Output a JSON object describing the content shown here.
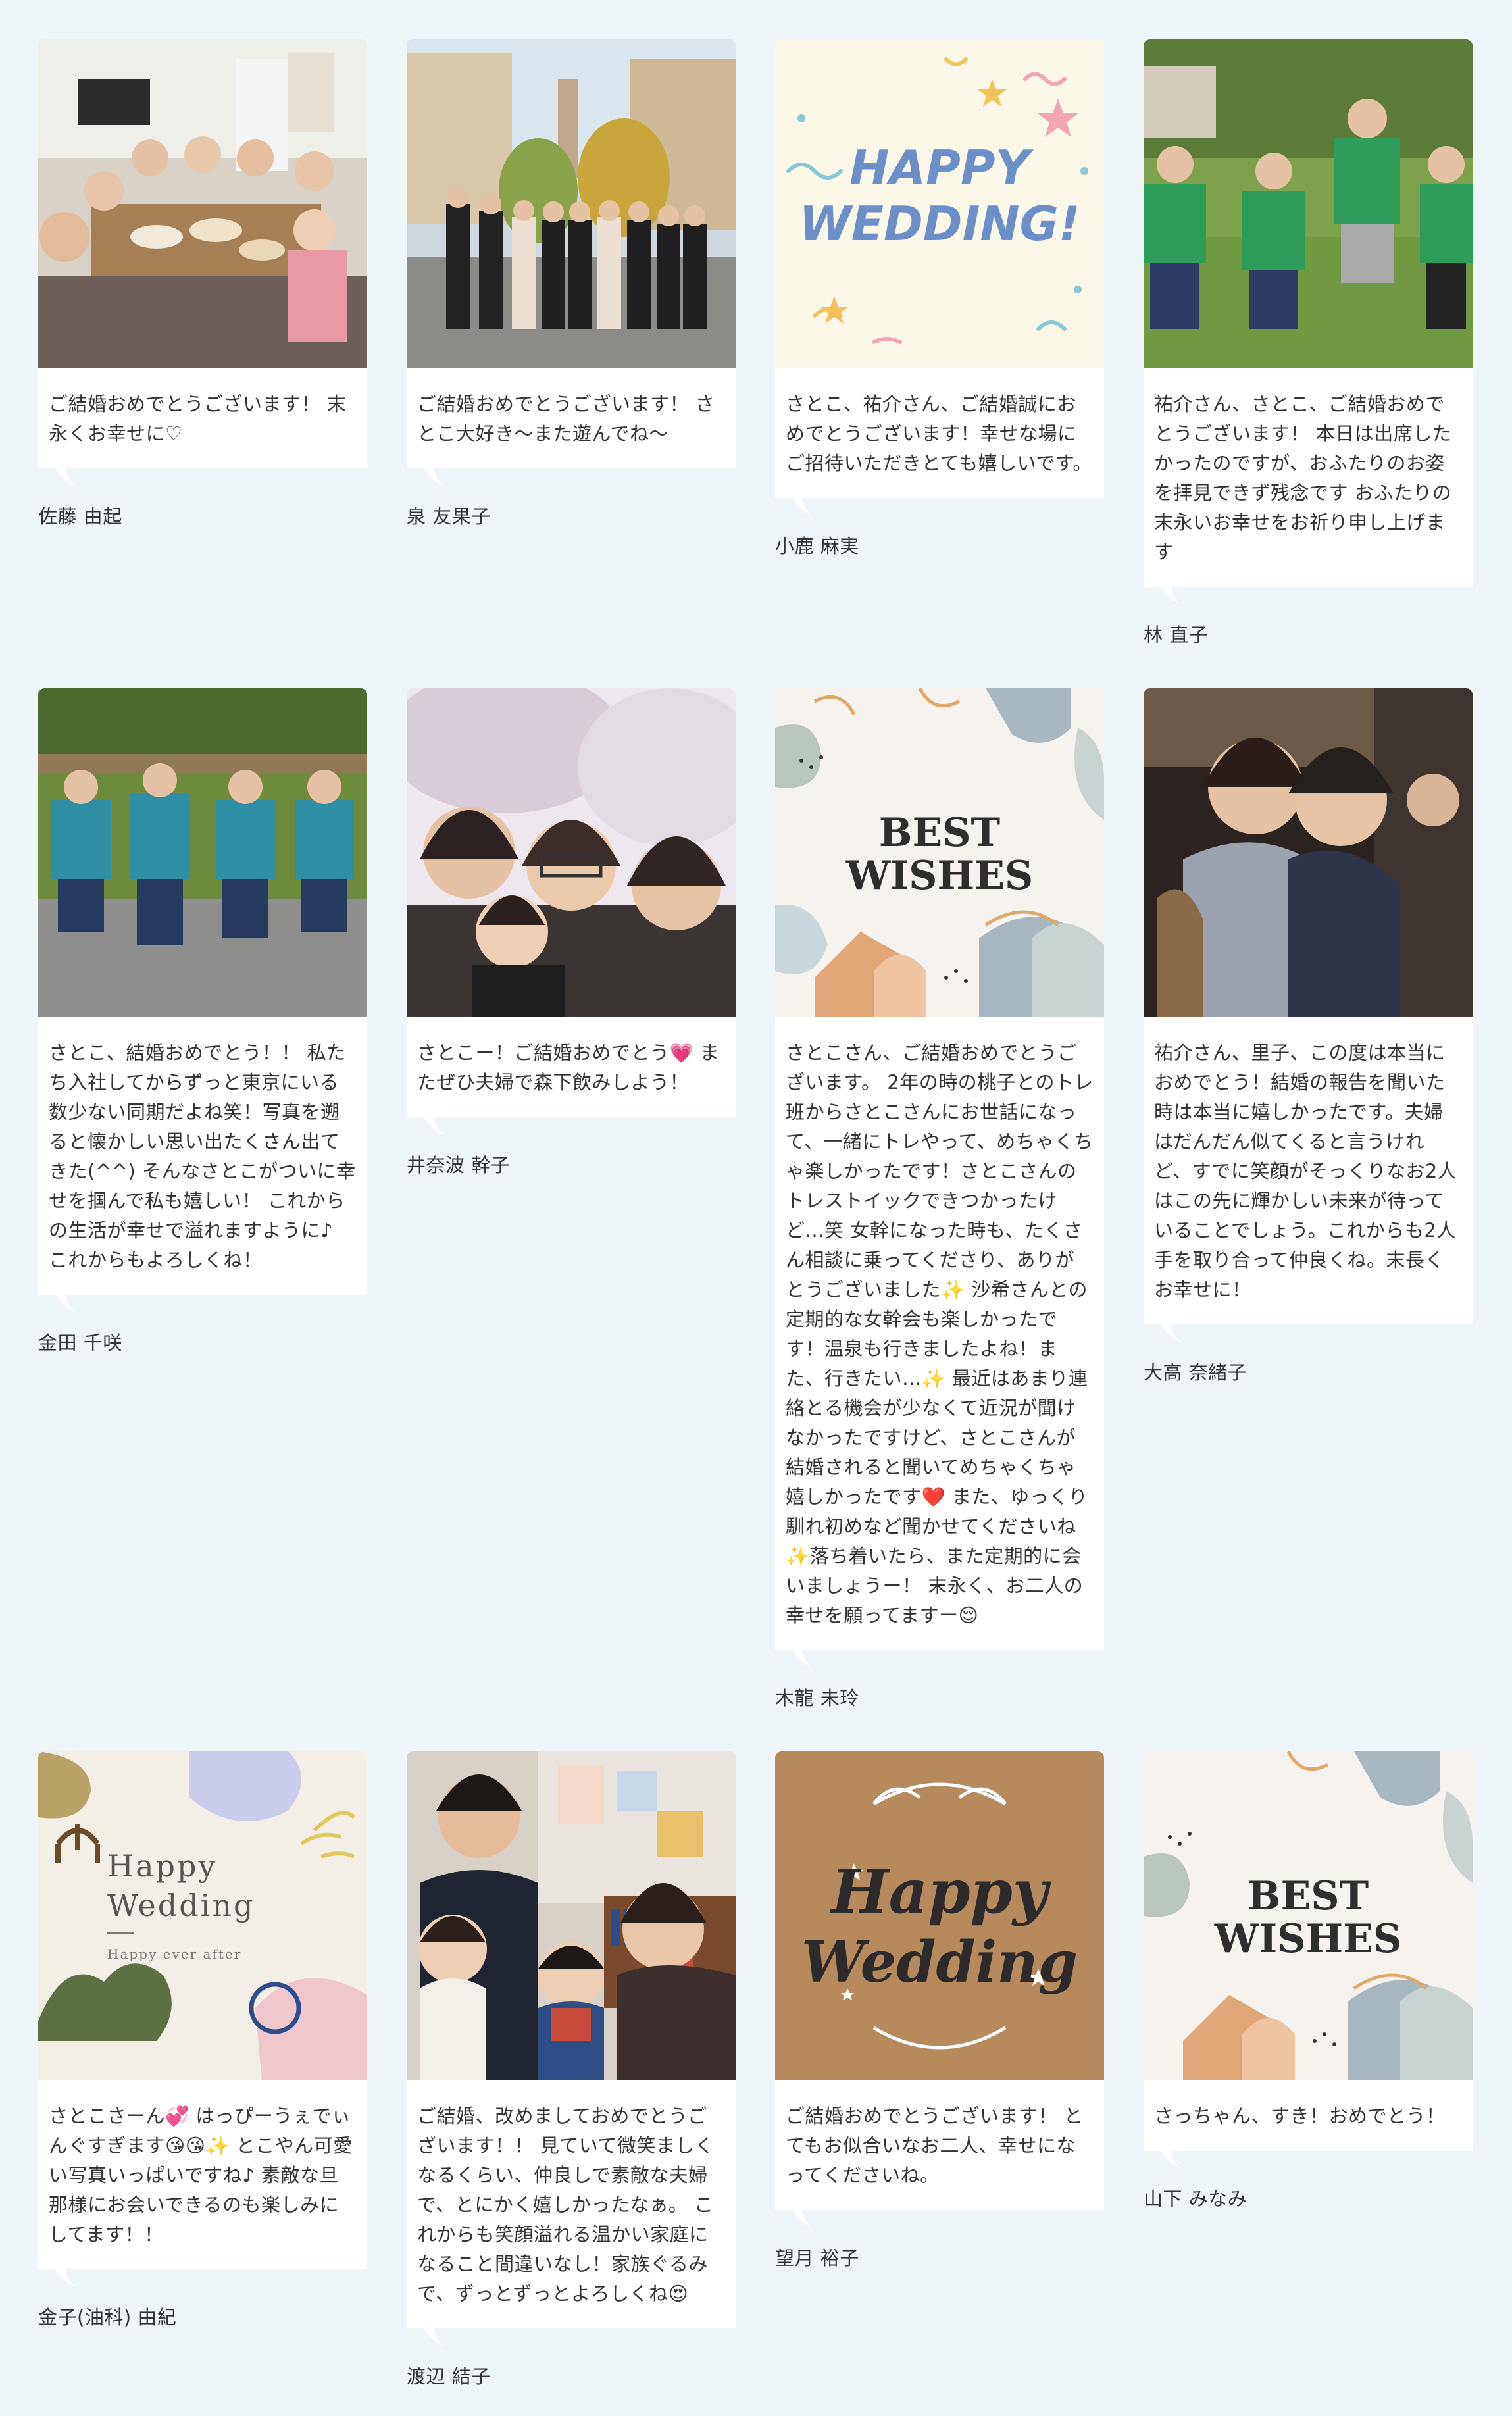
{
  "cards": [
    {
      "id": "c1",
      "message": "ご結婚おめでとうございます！ 末永くお幸せに♡",
      "author": "佐藤 由起",
      "image": "photo-group-dinner"
    },
    {
      "id": "c2",
      "message": "ご結婚おめでとうございます！ さとこ大好き〜また遊んでね〜",
      "author": "泉 友果子",
      "image": "photo-campus-group"
    },
    {
      "id": "c3",
      "message": "さとこ、祐介さん、ご結婚誠におめでとうございます！幸せな場にご招待いただきとても嬉しいです。",
      "author": "小鹿 麻実",
      "image": "card-happy-wedding-confetti",
      "card_title": "HAPPY WEDDING!"
    },
    {
      "id": "c4",
      "message": "祐介さん、さとこ、ご結婚おめでとうございます！ 本日は出席したかったのですが、おふたりのお姿を拝見できず残念です おふたりの末永いお幸せをお祈り申し上げます",
      "author": "林 直子",
      "image": "photo-green-shirts"
    },
    {
      "id": "c5",
      "message": "さとこ、結婚おめでとう！！ 私たち入社してからずっと東京にいる数少ない同期だよね笑！写真を遡ると懐かしい思い出たくさん出てきた(^^) そんなさとこがついに幸せを掴んで私も嬉しい！ これからの生活が幸せで溢れますように♪ これからもよろしくね！",
      "author": "金田 千咲",
      "image": "photo-sitting-friends"
    },
    {
      "id": "c6",
      "message": "さとこー！ご結婚おめでとう💗 またぜひ夫婦で森下飲みしよう！",
      "author": "井奈波 幹子",
      "image": "photo-cherry-blossom"
    },
    {
      "id": "c7",
      "message": "さとこさん、ご結婚おめでとうございます。 2年の時の桃子とのトレ班からさとこさんにお世話になって、一緒にトレやって、めちゃくちゃ楽しかったです！さとこさんのトレストイックできつかったけど…笑 女幹になった時も、たくさん相談に乗ってくださり、ありがとうございました✨ 沙希さんとの定期的な女幹会も楽しかったです！温泉も行きましたよね！また、行きたい…✨ 最近はあまり連絡とる機会が少なくて近況が聞けなかったですけど、さとこさんが結婚されると聞いてめちゃくちゃ嬉しかったです❤️ また、ゆっくり馴れ初めなど聞かせてくださいね✨落ち着いたら、また定期的に会いましょうー！ 末永く、お二人の幸せを願ってますー😌",
      "author": "木龍 未玲",
      "image": "card-best-wishes",
      "card_title": "BEST WISHES"
    },
    {
      "id": "c8",
      "message": "祐介さん、里子、この度は本当におめでとう！結婚の報告を聞いた時は本当に嬉しかったです。夫婦はだんだん似てくると言うけれど、すでに笑顔がそっくりなお2人はこの先に輝かしい未来が待っていることでしょう。これからも2人手を取り合って仲良くね。末長くお幸せに！",
      "author": "大高 奈緒子",
      "image": "photo-hug"
    },
    {
      "id": "c9",
      "message": "さとこさーん💞 はっぴーうぇでぃんぐすぎます😘😘✨ とこやん可愛い写真いっぱいですね♪ 素敵な旦那様にお会いできるのも楽しみにしてます！！",
      "author": "金子(油科) 由紀",
      "image": "card-happy-wedding-ever-after",
      "card_title": "Happy Wedding",
      "card_sub": "Happy ever after"
    },
    {
      "id": "c10",
      "message": "ご結婚、改めましておめでとうございます！！ 見ていて微笑ましくなるくらい、仲良しで素敵な夫婦で、とにかく嬉しかったなぁ。 これからも笑顔溢れる温かい家庭になること間違いなし！家族ぐるみで、ずっとずっとよろしくね😍",
      "author": "渡辺 結子",
      "image": "photo-family"
    },
    {
      "id": "c11",
      "message": "ご結婚おめでとうございます！ とてもお似合いなお二人、幸せになってくださいね。",
      "author": "望月 裕子",
      "image": "card-happy-wedding-script",
      "card_title": "Happy Wedding"
    },
    {
      "id": "c12",
      "message": "さっちゃん、すき！おめでとう！",
      "author": "山下 みなみ",
      "image": "card-best-wishes-2",
      "card_title": "BEST WISHES"
    }
  ],
  "colors": {
    "background": "#eef6f9",
    "card": "#ffffff",
    "text": "#333333"
  }
}
